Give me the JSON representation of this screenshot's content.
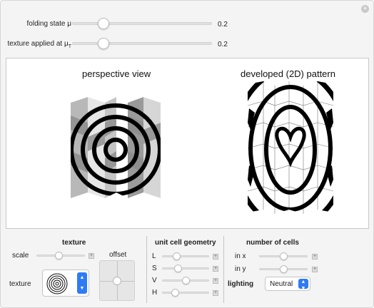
{
  "controls": {
    "folding_state": {
      "label": "folding state μ",
      "value": "0.2",
      "fraction": 0.2
    },
    "texture_applied": {
      "label": "texture applied at μ",
      "label_sub": "T",
      "value": "0.2",
      "fraction": 0.2
    }
  },
  "plot": {
    "perspective_title": "perspective view",
    "developed_title": "developed (2D) pattern"
  },
  "texture_panel": {
    "title": "texture",
    "scale_label": "scale",
    "offset_label": "offset",
    "texture_label": "texture"
  },
  "geometry_panel": {
    "title": "unit cell geometry",
    "params": [
      {
        "label": "L",
        "fraction": 0.25
      },
      {
        "label": "S",
        "fraction": 0.28
      },
      {
        "label": "V",
        "fraction": 0.42
      },
      {
        "label": "H",
        "fraction": 0.22
      }
    ]
  },
  "cells_panel": {
    "title": "number of cells",
    "in_x": {
      "label": "in x",
      "fraction": 0.45
    },
    "in_y": {
      "label": "in y",
      "fraction": 0.45
    },
    "lighting_label": "lighting",
    "lighting_value": "Neutral"
  },
  "icons": {
    "corner": "plus-icon",
    "texture_preview": "concentric-circles-icon",
    "dropdown": "chevron-updown-icon"
  }
}
